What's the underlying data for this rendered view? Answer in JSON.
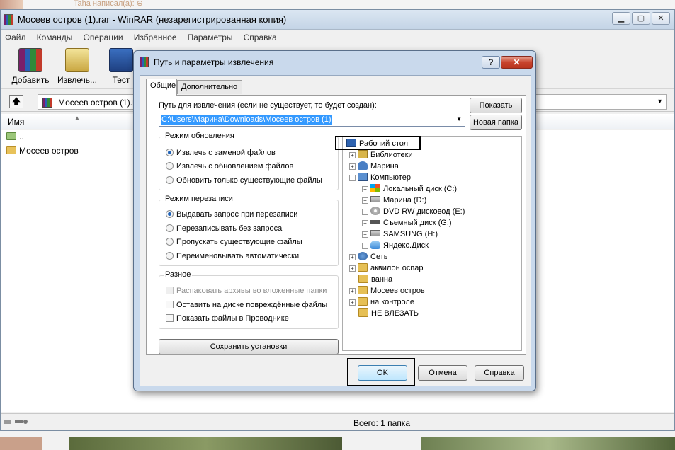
{
  "background": {
    "forum_quote": "Taha написал(а): ⊕"
  },
  "main_window": {
    "title": "Мосеев остров (1).rar - WinRAR (незарегистрированная копия)",
    "menu": [
      "Файл",
      "Команды",
      "Операции",
      "Избранное",
      "Параметры",
      "Справка"
    ],
    "toolbar": {
      "add_label": "Добавить",
      "extract_label": "Извлечь...",
      "test_label": "Тест"
    },
    "address": "Мосеев остров (1).rar",
    "list_header": "Имя",
    "list_items": [
      "..",
      "Мосеев остров"
    ],
    "status_text": "Всего: 1 папка"
  },
  "dialog": {
    "title": "Путь и параметры извлечения",
    "help_label": "?",
    "close_label": "✕",
    "tabs": [
      "Общие",
      "Дополнительно"
    ],
    "path_label": "Путь для извлечения (если не существует, то будет создан):",
    "path_value": "C:\\Users\\Марина\\Downloads\\Мосеев остров (1)",
    "show_button": "Показать",
    "new_folder_button": "Новая папка",
    "update_mode": {
      "title": "Режим обновления",
      "options": [
        "Извлечь с заменой файлов",
        "Извлечь с обновлением файлов",
        "Обновить только существующие файлы"
      ],
      "selected": 0
    },
    "overwrite_mode": {
      "title": "Режим перезаписи",
      "options": [
        "Выдавать запрос при перезаписи",
        "Перезаписывать без запроса",
        "Пропускать существующие файлы",
        "Переименовывать автоматически"
      ],
      "selected": 0
    },
    "misc": {
      "title": "Разное",
      "options": [
        "Распаковать архивы во вложенные папки",
        "Оставить на диске повреждённые файлы",
        "Показать файлы в Проводнике"
      ],
      "disabled_index": 0
    },
    "save_button": "Сохранить установки",
    "tree": [
      "Рабочий стол",
      "Библиотеки",
      "Марина",
      "Компьютер",
      "Локальный диск (C:)",
      "Марина (D:)",
      "DVD RW дисковод (E:)",
      "Съемный диск (G:)",
      "SAMSUNG (H:)",
      "Яндекс.Диск",
      "Сеть",
      "аквилон оспар",
      "ванна",
      "Мосеев остров",
      "на контроле",
      "НЕ ВЛЕЗАТЬ"
    ],
    "ok_button": "OK",
    "cancel_button": "Отмена",
    "help_button": "Справка"
  }
}
